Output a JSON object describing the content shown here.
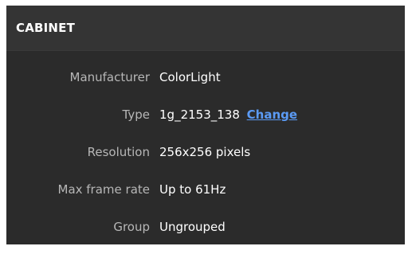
{
  "panel": {
    "title": "CABINET"
  },
  "properties": [
    {
      "label": "Manufacturer",
      "value": "ColorLight"
    },
    {
      "label": "Type",
      "value": "1g_2153_138",
      "link": "Change"
    },
    {
      "label": "Resolution",
      "value": "256x256 pixels"
    },
    {
      "label": "Max frame rate",
      "value": "Up to 61Hz"
    },
    {
      "label": "Group",
      "value": "Ungrouped"
    }
  ],
  "colors": {
    "panel_bg": "#2b2b2b",
    "header_bg": "#343434",
    "label_text": "#b7b7b7",
    "value_text": "#ffffff",
    "link": "#5b9bf5"
  }
}
